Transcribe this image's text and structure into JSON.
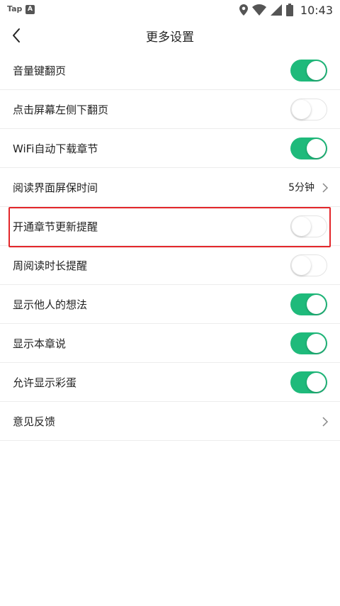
{
  "status_bar": {
    "app_label": "Tap",
    "a_icon_label": "A",
    "time": "10:43"
  },
  "header": {
    "title": "更多设置"
  },
  "settings": [
    {
      "label": "音量键翻页",
      "control": "toggle",
      "on": true
    },
    {
      "label": "点击屏幕左侧下翻页",
      "control": "toggle",
      "on": false
    },
    {
      "label": "WiFi自动下载章节",
      "control": "toggle",
      "on": true
    },
    {
      "label": "阅读界面屏保时间",
      "control": "value",
      "value": "5分钟"
    },
    {
      "label": "开通章节更新提醒",
      "control": "toggle",
      "on": false
    },
    {
      "label": "周阅读时长提醒",
      "control": "toggle",
      "on": false
    },
    {
      "label": "显示他人的想法",
      "control": "toggle",
      "on": true
    },
    {
      "label": "显示本章说",
      "control": "toggle",
      "on": true
    },
    {
      "label": "允许显示彩蛋",
      "control": "toggle",
      "on": true
    },
    {
      "label": "意见反馈",
      "control": "link"
    }
  ],
  "colors": {
    "accent": "#1fba7b",
    "highlight": "#e3262a"
  },
  "icons": [
    "location-icon",
    "wifi-icon",
    "signal-icon",
    "battery-icon",
    "back-arrow-icon",
    "chevron-right-icon"
  ]
}
